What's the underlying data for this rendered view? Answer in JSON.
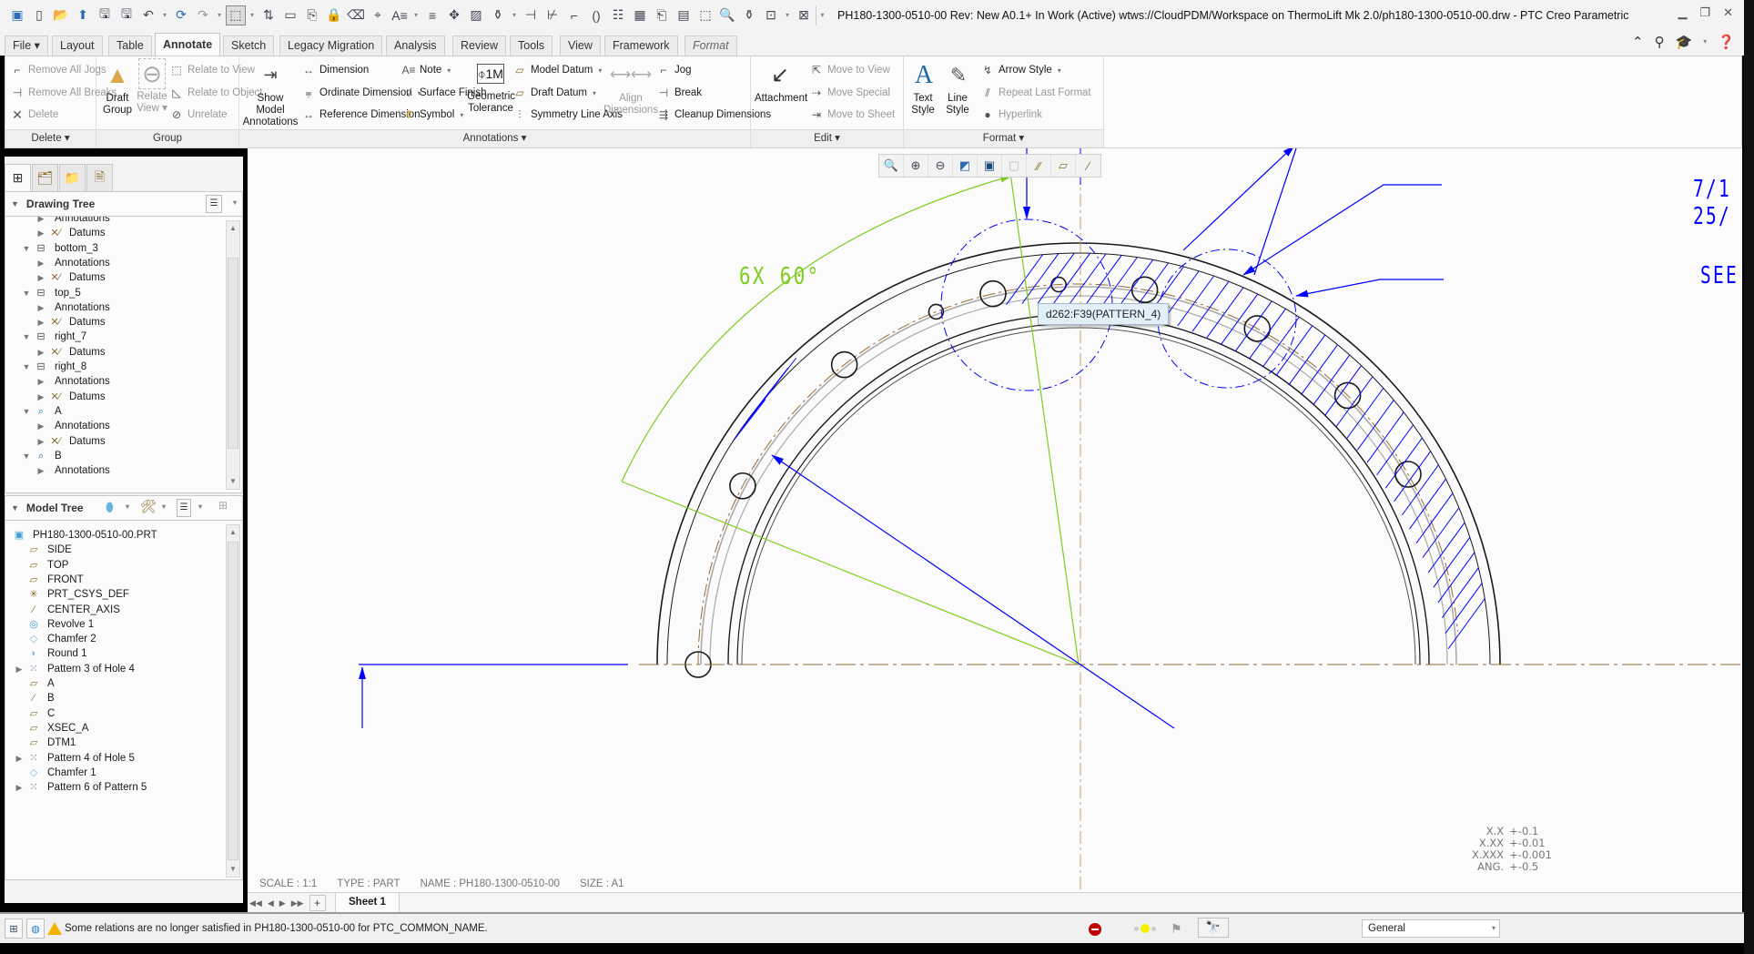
{
  "window": {
    "title": "PH180-1300-0510-00 Rev: New A0.1+ In Work  (Active) wtws://CloudPDM/Workspace on ThermoLift Mk 2.0/ph180-1300-0510-00.drw - PTC Creo Parametric",
    "controls": [
      "minimize-icon",
      "restore-icon",
      "close-icon"
    ]
  },
  "quick_access": [
    "app-icon",
    "new-icon",
    "open-icon",
    "save-icon",
    "save-as-icon",
    "undo-icon",
    "redo-icon",
    "select-box-icon",
    "regenerate-icon",
    "window-icon",
    "close-window-icon"
  ],
  "tabs": [
    {
      "label": "File ▾",
      "active": false
    },
    {
      "label": "Layout",
      "active": false
    },
    {
      "label": "Table",
      "active": false
    },
    {
      "label": "Annotate",
      "active": true
    },
    {
      "label": "Sketch",
      "active": false
    },
    {
      "label": "Legacy Migration",
      "active": false
    },
    {
      "label": "Analysis",
      "active": false
    },
    {
      "label": "Review",
      "active": false
    },
    {
      "label": "Tools",
      "active": false
    },
    {
      "label": "View",
      "active": false
    },
    {
      "label": "Framework",
      "active": false
    },
    {
      "label": "Format",
      "active": false
    }
  ],
  "ribbon": {
    "delete_group": {
      "remove_all_jogs": "Remove All Jogs",
      "remove_all_breaks": "Remove All Breaks",
      "delete": "Delete",
      "footer": "Delete ▾"
    },
    "group_group": {
      "draft_group": [
        "Draft",
        "Group"
      ],
      "relate_view": [
        "Relate",
        "View ▾"
      ],
      "relate_to_view": "Relate to View",
      "relate_to_object": "Relate to Object",
      "unrelate": "Unrelate",
      "footer": "Group"
    },
    "annotations_group": {
      "show_model_annotations": [
        "Show Model",
        "Annotations"
      ],
      "dimension": "Dimension",
      "ordinate_dimension": "Ordinate Dimension",
      "reference_dimension": "Reference Dimension",
      "note": "Note",
      "surface_finish": "Surface Finish",
      "symbol": "Symbol",
      "geometric_tolerance": [
        "Geometric",
        "Tolerance"
      ],
      "model_datum": "Model Datum",
      "draft_datum": "Draft Datum",
      "symmetry_line_axis": "Symmetry Line Axis",
      "align_dimensions": [
        "Align",
        "Dimensions"
      ],
      "jog": "Jog",
      "break": "Break",
      "cleanup_dimensions": "Cleanup Dimensions",
      "footer": "Annotations ▾"
    },
    "edit_group": {
      "attachment": "Attachment",
      "move_to_view": "Move to View",
      "move_special": "Move Special",
      "move_to_sheet": "Move to Sheet",
      "footer": "Edit ▾"
    },
    "format_group": {
      "text_style": [
        "Text",
        "Style"
      ],
      "line_style": [
        "Line",
        "Style"
      ],
      "arrow_style": "Arrow Style",
      "repeat_last_format": "Repeat Last Format",
      "hyperlink": "Hyperlink",
      "footer": "Format ▾"
    }
  },
  "drawing_tree": {
    "title": "Drawing Tree",
    "items": [
      {
        "label": "Annotations",
        "level": 2,
        "expander": "▶",
        "icon": "annotations"
      },
      {
        "label": "Datums",
        "level": 2,
        "expander": "▶",
        "icon": "datums"
      },
      {
        "label": "bottom_3",
        "level": 1,
        "expander": "▼",
        "icon": "view"
      },
      {
        "label": "Annotations",
        "level": 2,
        "expander": "▶",
        "icon": "annotations"
      },
      {
        "label": "Datums",
        "level": 2,
        "expander": "▶",
        "icon": "datums"
      },
      {
        "label": "top_5",
        "level": 1,
        "expander": "▼",
        "icon": "view"
      },
      {
        "label": "Annotations",
        "level": 2,
        "expander": "▶",
        "icon": "annotations"
      },
      {
        "label": "Datums",
        "level": 2,
        "expander": "▶",
        "icon": "datums"
      },
      {
        "label": "right_7",
        "level": 1,
        "expander": "▼",
        "icon": "view"
      },
      {
        "label": "Datums",
        "level": 2,
        "expander": "▶",
        "icon": "datums"
      },
      {
        "label": "right_8",
        "level": 1,
        "expander": "▼",
        "icon": "view"
      },
      {
        "label": "Annotations",
        "level": 2,
        "expander": "▶",
        "icon": "annotations"
      },
      {
        "label": "Datums",
        "level": 2,
        "expander": "▶",
        "icon": "datums"
      },
      {
        "label": "A",
        "level": 1,
        "expander": "▼",
        "icon": "detail-view"
      },
      {
        "label": "Annotations",
        "level": 2,
        "expander": "▶",
        "icon": "annotations"
      },
      {
        "label": "Datums",
        "level": 2,
        "expander": "▶",
        "icon": "datums"
      },
      {
        "label": "B",
        "level": 1,
        "expander": "▼",
        "icon": "detail-view"
      },
      {
        "label": "Annotations",
        "level": 2,
        "expander": "▶",
        "icon": "annotations"
      }
    ]
  },
  "model_tree": {
    "title": "Model Tree",
    "items": [
      {
        "label": "PH180-1300-0510-00.PRT",
        "level": 0,
        "expander": "",
        "icon": "part"
      },
      {
        "label": "SIDE",
        "level": 1,
        "expander": "",
        "icon": "plane"
      },
      {
        "label": "TOP",
        "level": 1,
        "expander": "",
        "icon": "plane"
      },
      {
        "label": "FRONT",
        "level": 1,
        "expander": "",
        "icon": "plane"
      },
      {
        "label": "PRT_CSYS_DEF",
        "level": 1,
        "expander": "",
        "icon": "csys"
      },
      {
        "label": "CENTER_AXIS",
        "level": 1,
        "expander": "",
        "icon": "axis"
      },
      {
        "label": "Revolve 1",
        "level": 1,
        "expander": "",
        "icon": "revolve"
      },
      {
        "label": "Chamfer 2",
        "level": 1,
        "expander": "",
        "icon": "chamfer"
      },
      {
        "label": "Round 1",
        "level": 1,
        "expander": "",
        "icon": "round"
      },
      {
        "label": "Pattern 3 of Hole 4",
        "level": 1,
        "expander": "▶",
        "icon": "pattern"
      },
      {
        "label": "A",
        "level": 1,
        "expander": "",
        "icon": "plane"
      },
      {
        "label": "B",
        "level": 1,
        "expander": "",
        "icon": "axis"
      },
      {
        "label": "C",
        "level": 1,
        "expander": "",
        "icon": "plane"
      },
      {
        "label": "XSEC_A",
        "level": 1,
        "expander": "",
        "icon": "plane"
      },
      {
        "label": "DTM1",
        "level": 1,
        "expander": "",
        "icon": "plane"
      },
      {
        "label": "Pattern 4 of Hole 5",
        "level": 1,
        "expander": "▶",
        "icon": "pattern"
      },
      {
        "label": "Chamfer 1",
        "level": 1,
        "expander": "",
        "icon": "chamfer"
      },
      {
        "label": "Pattern 6 of Pattern 5",
        "level": 1,
        "expander": "▶",
        "icon": "pattern"
      }
    ]
  },
  "view_toolbar": [
    "refit-icon",
    "zoom-in-icon",
    "zoom-out-icon",
    "repaint-icon",
    "display-style-icon",
    "saved-views-icon",
    "datum-display-icon",
    "plane-display-icon",
    "axis-display-icon"
  ],
  "drawing": {
    "tooltip": "d262:F39(PATTERN_4)",
    "angle_dim": "6X 60°",
    "note_partial_1": "7/1",
    "note_partial_2": "25/",
    "note_partial_3": "SEE",
    "title_block": {
      "scale": "SCALE : 1:1",
      "type": "TYPE : PART",
      "name": "NAME : PH180-1300-0510-00",
      "size": "SIZE : A1"
    },
    "tolerances": [
      {
        "key": "X.X",
        "value": "+-0.1"
      },
      {
        "key": "X.XX",
        "value": "+-0.01"
      },
      {
        "key": "X.XXX",
        "value": "+-0.001"
      },
      {
        "key": "ANG.",
        "value": "+-0.5"
      }
    ],
    "colors": {
      "dimension": "#0000ff",
      "angle_dim": "#7fcc20",
      "centerline": "#9a6a30",
      "geometry": "#1a1a1a"
    }
  },
  "sheets": {
    "tabs": [
      "Sheet 1"
    ],
    "active": "Sheet 1",
    "add": "+"
  },
  "status": {
    "message": "Some relations are no longer satisfied in PH180-1300-0510-00 for PTC_COMMON_NAME.",
    "filter": "General"
  }
}
